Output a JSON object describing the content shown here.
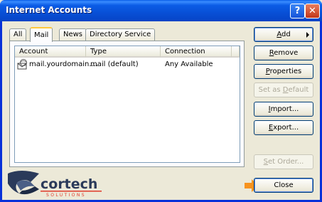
{
  "window": {
    "title": "Internet Accounts"
  },
  "titlebar": {
    "help_glyph": "?",
    "close_glyph": "✕"
  },
  "tabs": [
    {
      "label": "All"
    },
    {
      "label": "Mail"
    },
    {
      "label": "News"
    },
    {
      "label": "Directory Service"
    }
  ],
  "list": {
    "columns": [
      "Account",
      "Type",
      "Connection"
    ],
    "rows": [
      {
        "account": "mail.yourdomain....",
        "type": "mail (default)",
        "connection": "Any Available",
        "icon": "mail-account-icon"
      }
    ]
  },
  "buttons": {
    "add": {
      "pre": "",
      "u": "A",
      "post": "dd"
    },
    "remove": {
      "pre": "",
      "u": "R",
      "post": "emove"
    },
    "properties": {
      "pre": "",
      "u": "P",
      "post": "roperties"
    },
    "set_default": {
      "pre": "Set as ",
      "u": "D",
      "post": "efault"
    },
    "import": {
      "pre": "",
      "u": "I",
      "post": "mport..."
    },
    "export": {
      "pre": "",
      "u": "E",
      "post": "xport..."
    },
    "set_order": {
      "pre": "",
      "u": "S",
      "post": "et Order..."
    },
    "close": "Close"
  },
  "logo": {
    "name": "cortech",
    "sub": "SOLUTIONS"
  },
  "colors": {
    "accent": "#0a5fe8",
    "arrow": "#f7931e",
    "logo_dark": "#2a3a5a"
  }
}
